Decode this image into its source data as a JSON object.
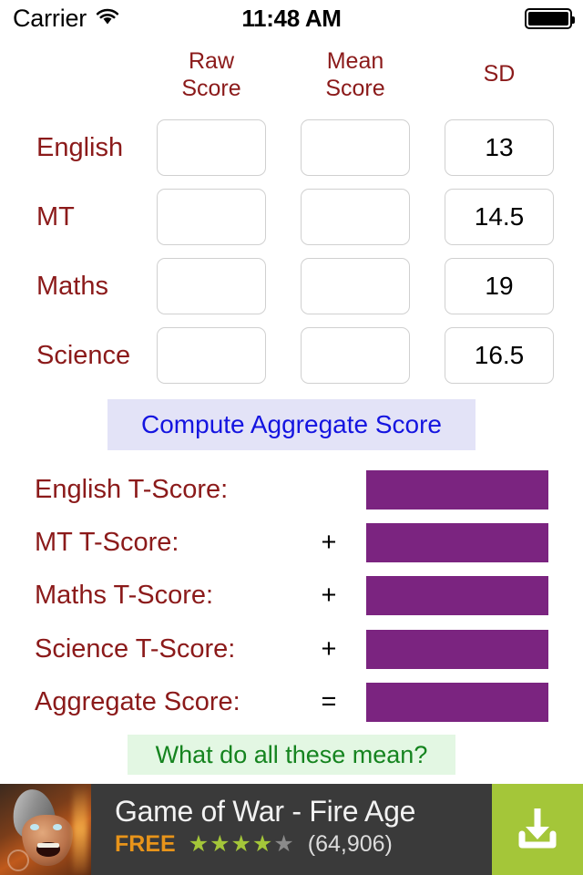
{
  "status_bar": {
    "carrier": "Carrier",
    "wifi_icon": "wifi-icon",
    "time": "11:48 AM",
    "battery_icon": "battery-full-icon"
  },
  "input_table": {
    "headers": {
      "subject": "",
      "raw_score": "Raw\nScore",
      "raw_score_line1": "Raw",
      "raw_score_line2": "Score",
      "mean_score_line1": "Mean",
      "mean_score_line2": "Score",
      "sd": "SD"
    },
    "rows": [
      {
        "subject": "English",
        "raw_score": "",
        "mean_score": "",
        "sd": "13"
      },
      {
        "subject": "MT",
        "raw_score": "",
        "mean_score": "",
        "sd": "14.5"
      },
      {
        "subject": "Maths",
        "raw_score": "",
        "mean_score": "",
        "sd": "19"
      },
      {
        "subject": "Science",
        "raw_score": "",
        "mean_score": "",
        "sd": "16.5"
      }
    ]
  },
  "compute_button": {
    "label": "Compute Aggregate Score"
  },
  "results": {
    "rows": [
      {
        "label": "English T-Score:",
        "operator": "",
        "value": ""
      },
      {
        "label": "MT T-Score:",
        "operator": "+",
        "value": ""
      },
      {
        "label": "Maths T-Score:",
        "operator": "+",
        "value": ""
      },
      {
        "label": "Science T-Score:",
        "operator": "+",
        "value": ""
      },
      {
        "label": "Aggregate Score:",
        "operator": "=",
        "value": ""
      }
    ]
  },
  "help_button": {
    "label": "What do all these mean?"
  },
  "ad": {
    "icon": "game-app-icon",
    "title": "Game of War - Fire Age",
    "price": "FREE",
    "stars_filled": 4,
    "stars_total": 5,
    "rating_count": "(64,906)",
    "cta_icon": "download-icon"
  },
  "colors": {
    "label_red": "#8B1A1A",
    "value_purple": "#7B2480",
    "compute_blue": "#1414E0",
    "compute_bg": "#E3E3F7",
    "help_green": "#15841F",
    "help_bg": "#E3F7E3",
    "ad_bg": "#3A3A3A",
    "ad_cta_green": "#A4C639",
    "ad_free_orange": "#E8941A"
  }
}
